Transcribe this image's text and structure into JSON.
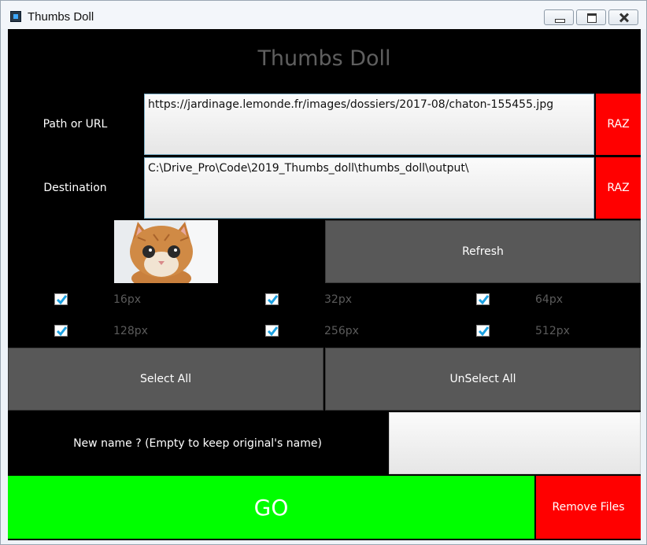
{
  "window": {
    "title": "Thumbs Doll"
  },
  "heading": "Thumbs Doll",
  "path": {
    "label": "Path or URL",
    "value": "https://jardinage.lemonde.fr/images/dossiers/2017-08/chaton-155455.jpg",
    "reset_label": "RAZ"
  },
  "destination": {
    "label": "Destination",
    "value": "C:\\Drive_Pro\\Code\\2019_Thumbs_doll\\thumbs_doll\\output\\",
    "reset_label": "RAZ"
  },
  "preview": {
    "subject": "kitten photo"
  },
  "refresh_label": "Refresh",
  "sizes": [
    {
      "label": "16px",
      "checked": true
    },
    {
      "label": "32px",
      "checked": true
    },
    {
      "label": "64px",
      "checked": true
    },
    {
      "label": "128px",
      "checked": true
    },
    {
      "label": "256px",
      "checked": true
    },
    {
      "label": "512px",
      "checked": true
    }
  ],
  "select_all_label": "Select All",
  "unselect_all_label": "UnSelect All",
  "new_name": {
    "label": "New name ? (Empty to keep original's name)",
    "value": ""
  },
  "go_label": "GO",
  "remove_files_label": "Remove Files",
  "colors": {
    "accent_red": "#ff0000",
    "go_green": "#00ff00",
    "button_gray": "#585858",
    "check_blue": "#1ba1e2"
  }
}
